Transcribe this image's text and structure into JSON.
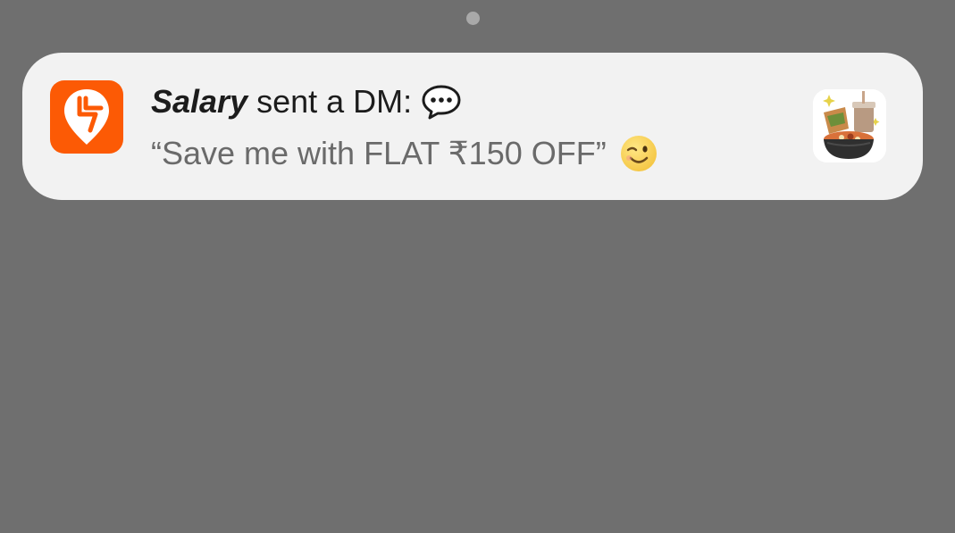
{
  "colors": {
    "background": "#6f6f6f",
    "card": "#f2f2f2",
    "brand_orange": "#fc5a05",
    "title_text": "#1c1c1c",
    "body_text": "#6a6a6a"
  },
  "pager": {
    "icon": "page-indicator-dot"
  },
  "notification": {
    "app_icon": "swiggy-logo-icon",
    "sender": "Salary",
    "title_rest": "sent a DM:",
    "title_emoji": "speech-bubble-icon",
    "message": "“Save me with FLAT ₹150 OFF”",
    "message_emoji": "winking-face-icon",
    "thumbnail": "food-bowl-thumbnail"
  }
}
